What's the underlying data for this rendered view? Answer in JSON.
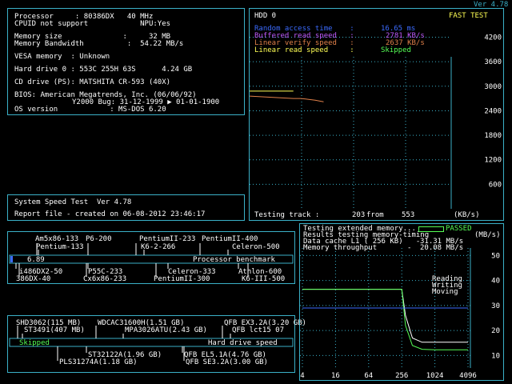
{
  "version": "Ver 4.78",
  "sysinfo": {
    "lines": [
      {
        "label": "Processor     : 80386DX   40 MHz",
        "cls": "w"
      },
      {
        "label": "CPUID not support            NPU:Yes",
        "cls": "w"
      },
      {
        "label": "Memory size              :     32 MB",
        "cls": "w"
      },
      {
        "label": "Memory Bandwidth          :  54.22 MB/s",
        "cls": "w"
      },
      {
        "label": "VESA memory  : Unknown",
        "cls": "w"
      },
      {
        "label": "Hard drive 0 : 553C 255H 63S      4.24 GB",
        "cls": "w"
      },
      {
        "label": "CD drive (PS): MATSHITA CR-593 (40X)",
        "cls": "w"
      },
      {
        "label": "BIOS: American Megatrends, Inc. (06/06/92)",
        "cls": "w"
      },
      {
        "label": "Y2000 Bug: 31-12-1999 ▶ 01-01-1900",
        "cls": "w"
      },
      {
        "label": "OS version            : MS-DOS 6.20",
        "cls": "w"
      }
    ]
  },
  "speedtest": {
    "title": "System Speed Test  Ver 4.78",
    "report": "Report file - created on 06-08-2012 23:46:17"
  },
  "hdd": {
    "title": "HDD 0",
    "mode": "FAST TEST",
    "rows": [
      {
        "label": "Random access time    :",
        "value": "16.65 ms",
        "cls": "b"
      },
      {
        "label": "Buffered read speed   :",
        "value": "2781 KB/s",
        "cls": "m"
      },
      {
        "label": "Linear verify speed   :",
        "value": "2637 KB/s",
        "cls": "o"
      },
      {
        "label": "Linear read speed     :",
        "value": "Skipped",
        "cls": "y"
      }
    ],
    "status_prefix": "Testing track :",
    "track": "203",
    "from_word": "from",
    "total": "553",
    "unit": "(KB/s)"
  },
  "memtest": {
    "line1": "Testing extended memory...",
    "passed": "PASSED",
    "line2": "Results testing memory-timing",
    "unit": "(MB/s)",
    "cache_label": "Data cache L1 ( 256 KB)   -",
    "cache_value": "31.31 MB/s",
    "throughput_label": "Memory throughput       -",
    "throughput_value": "20.08 MB/s",
    "legend": [
      "Reading",
      "Writing",
      "Moving"
    ]
  },
  "cpu_bench": {
    "score": "6.89",
    "label": "Processor benchmark",
    "top_refs": [
      "Am5x86-133",
      "P6-200",
      "PentiumII-233",
      "PentiumII-400",
      "Pentium-133",
      "K6-2-266",
      "Celeron-500"
    ],
    "bottom_refs": [
      "i486DX2-50",
      "P55C-233",
      "Celeron-333",
      "Athlon-600",
      "386DX-40",
      "Cx6x86-233",
      "PentiumII-300",
      "K6-III-500"
    ]
  },
  "hdd_bench": {
    "status": "Skipped",
    "label": "Hard drive speed",
    "top_refs": [
      "SHD3062(115 MB)",
      "WDCAC31600H(1.51 GB)",
      "QFB EX3.2A(3.20 GB)",
      "ST3491(407 MB)",
      "MPA3026ATU(2.43 GB)",
      "QFB lct15 07"
    ],
    "bottom_refs": [
      "ST32122A(1.96 GB)",
      "QFB EL5.1A(4.76 GB)",
      "PLS31274A(1.18 GB)",
      "QFB SE3.2A(3.00 GB)"
    ]
  },
  "chart_data": [
    {
      "type": "line",
      "title": "HDD 0",
      "ylabel": "(KB/s)",
      "yticks": [
        600,
        1200,
        1800,
        2400,
        3000,
        3600,
        4200
      ],
      "ylim": [
        0,
        4700
      ],
      "xlim": [
        0,
        553
      ],
      "grid": true,
      "series": [
        {
          "name": "Linear verify speed",
          "color": "#e0804a",
          "x": [
            0,
            20,
            40,
            60,
            80,
            100,
            120,
            140,
            160,
            180,
            203
          ],
          "values": [
            2760,
            2750,
            2740,
            2730,
            2720,
            2710,
            2700,
            2700,
            2680,
            2660,
            2620
          ]
        },
        {
          "name": "Buffered read speed",
          "color": "#ffff55",
          "x": [
            0,
            20,
            40,
            60,
            80,
            100,
            120
          ],
          "values": [
            2880,
            2880,
            2880,
            2880,
            2880,
            2880,
            2880
          ]
        }
      ]
    },
    {
      "type": "line",
      "title": "Results testing memory-timing",
      "ylabel": "(MB/s)",
      "yticks": [
        10,
        20,
        30,
        40,
        50
      ],
      "xticks": [
        4,
        16,
        64,
        256,
        1024,
        4096
      ],
      "ylim": [
        5,
        53
      ],
      "log_x": true,
      "grid": true,
      "series": [
        {
          "name": "Reading",
          "color": "#ffffff",
          "x": [
            4,
            16,
            64,
            128,
            256,
            300,
            400,
            600,
            1024,
            2048,
            4096
          ],
          "values": [
            36.5,
            36.5,
            36.5,
            36.5,
            36.5,
            26,
            17,
            15.3,
            15.3,
            15.3,
            15.3
          ]
        },
        {
          "name": "Writing",
          "color": "#55ff55",
          "x": [
            4,
            16,
            64,
            128,
            256,
            300,
            400,
            600,
            1024,
            2048,
            4096
          ],
          "values": [
            36.5,
            36.5,
            36.5,
            36.5,
            36.5,
            22,
            14,
            12.5,
            12.3,
            12.3,
            12.3
          ]
        },
        {
          "name": "Moving",
          "color": "#3b6bff",
          "x": [
            4,
            16,
            64,
            256,
            1024,
            4096
          ],
          "values": [
            29,
            29,
            29,
            29,
            29,
            29
          ]
        }
      ]
    }
  ],
  "colors": {
    "border": "#3ab0c8",
    "accent": "#3b6bff",
    "pass": "#55ff55"
  }
}
